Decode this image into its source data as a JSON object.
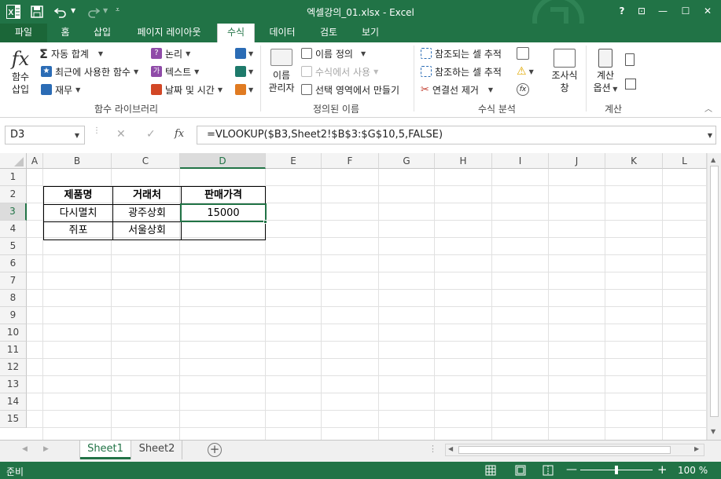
{
  "window": {
    "title": "엑셀강의_01.xlsx - Excel",
    "help": "?",
    "restore_ribbon": "⊡",
    "minimize": "—",
    "maximize": "☐",
    "close": "✕"
  },
  "tabs": [
    "파일",
    "홈",
    "삽입",
    "페이지 레이아웃",
    "수식",
    "데이터",
    "검토",
    "보기"
  ],
  "ribbon": {
    "insert_function": [
      "함수",
      "삽입"
    ],
    "autosum": "자동 합계",
    "recently_used": "최근에 사용한 함수",
    "financial": "재무",
    "logical": "논리",
    "text": "텍스트",
    "date_time": "날짜 및 시간",
    "group_function_library": "함수 라이브러리",
    "name_manager": [
      "이름",
      "관리자"
    ],
    "define_name": "이름 정의",
    "use_in_formula": "수식에서 사용",
    "create_from_selection": "선택 영역에서 만들기",
    "group_defined_names": "정의된 이름",
    "trace_precedents": "참조되는 셀 추적",
    "trace_dependents": "참조하는 셀 추적",
    "remove_arrows": "연결선 제거",
    "group_formula_auditing": "수식 분석",
    "watch_window": [
      "조사식",
      "창"
    ],
    "calc_options": [
      "계산",
      "옵션"
    ],
    "group_calculation": "계산"
  },
  "formula_bar": {
    "name_box": "D3",
    "cancel": "✕",
    "enter": "✓",
    "fx": "fx",
    "formula": "=VLOOKUP($B3,Sheet2!$B$3:$G$10,5,FALSE)"
  },
  "columns": [
    "A",
    "B",
    "C",
    "D",
    "E",
    "F",
    "G",
    "H",
    "I",
    "J",
    "K",
    "L"
  ],
  "rows": [
    "1",
    "2",
    "3",
    "4",
    "5",
    "6",
    "7",
    "8",
    "9",
    "10",
    "11",
    "12",
    "13",
    "14",
    "15"
  ],
  "table": {
    "headers": [
      "제품명",
      "거래처",
      "판매가격"
    ],
    "rows": [
      [
        "다시멸치",
        "광주상회",
        "15000"
      ],
      [
        "쥐포",
        "서울상회",
        ""
      ]
    ]
  },
  "selected_cell": "D3",
  "sheets": [
    "Sheet1",
    "Sheet2"
  ],
  "active_sheet": "Sheet1",
  "status": {
    "mode": "준비",
    "zoom": "100 %"
  },
  "colors": {
    "excel_green": "#217346",
    "ribbon_bg": "#ffffff",
    "grid_line": "#e1e1e1",
    "header_bg": "#f4f4f4"
  }
}
